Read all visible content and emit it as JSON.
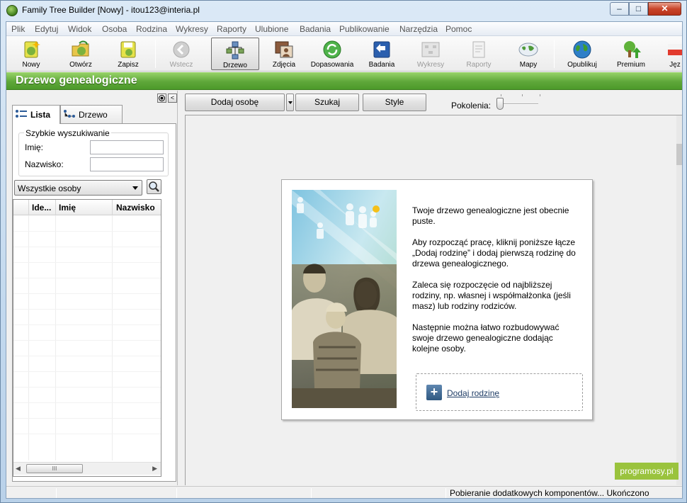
{
  "window": {
    "title": "Family Tree Builder [Nowy] - itou123@interia.pl",
    "minimize_glyph": "–",
    "maximize_glyph": "□",
    "close_glyph": "✕"
  },
  "menu": [
    "Plik",
    "Edytuj",
    "Widok",
    "Osoba",
    "Rodzina",
    "Wykresy",
    "Raporty",
    "Ulubione",
    "Badania",
    "Publikowanie",
    "Narzędzia",
    "Pomoc"
  ],
  "toolbar": {
    "nowy": "Nowy",
    "otworz": "Otwórz",
    "zapisz": "Zapisz",
    "wstecz": "Wstecz",
    "drzewo": "Drzewo",
    "zdjecia": "Zdjęcia",
    "dopasowania": "Dopasowania",
    "badania": "Badania",
    "wykresy": "Wykresy",
    "raporty": "Raporty",
    "mapy": "Mapy",
    "opublikuj": "Opublikuj",
    "premium": "Premium",
    "jezyk": "Jęz"
  },
  "banner": {
    "title": "Drzewo genealogiczne"
  },
  "left_panel": {
    "collapse_glyph": "<",
    "tabs": {
      "lista": "Lista",
      "drzewo": "Drzewo"
    },
    "quick_search": {
      "legend": "Szybkie wyszukiwanie",
      "first_name_label": "Imię:",
      "first_name_value": "",
      "last_name_label": "Nazwisko:",
      "last_name_value": ""
    },
    "filter": {
      "selected": "Wszystkie osoby"
    },
    "grid": {
      "columns": [
        "Ide...",
        "Imię",
        "Nazwisko"
      ],
      "rows": []
    },
    "scroll_grip": "III"
  },
  "right_pane": {
    "buttons": {
      "add_person": "Dodaj osobę",
      "search": "Szukaj",
      "styles": "Style"
    },
    "generations_label": "Pokolenia:",
    "welcome": {
      "p1": "Twoje drzewo genealogiczne jest obecnie puste.",
      "p2": "Aby rozpocząć pracę, kliknij poniższe łącze „Dodaj rodzinę” i dodaj pierwszą rodzinę do drzewa genealogicznego.",
      "p3": "Zaleca się rozpoczęcie od najbliższej rodziny, np. własnej i współmałżonka (jeśli masz) lub rodziny rodziców.",
      "p4": "Następnie można łatwo rozbudowywać swoje drzewo genealogiczne dodając kolejne osoby.",
      "add_family_link": "Dodaj rodzinę",
      "add_family_icon_glyph": "+"
    }
  },
  "status": {
    "text": "Pobieranie dodatkowych komponentów... Ukończono"
  },
  "watermark": "programosy.pl",
  "colors": {
    "banner_green": "#5fa73a",
    "link_blue": "#1f3d66",
    "watermark_green": "#9ac33d"
  }
}
